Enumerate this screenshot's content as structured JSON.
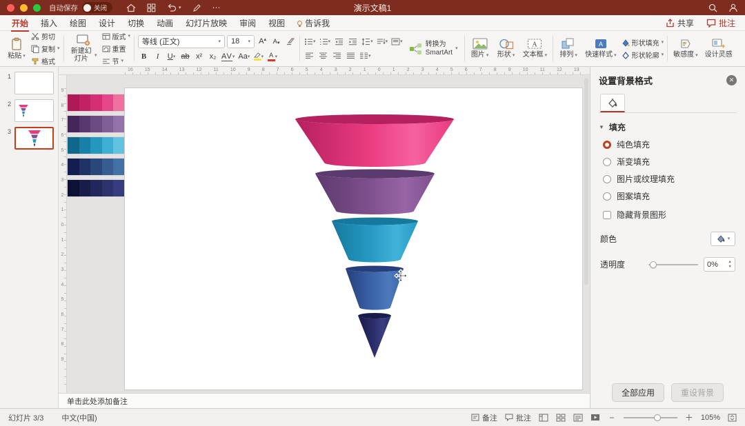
{
  "titlebar": {
    "title": "演示文稿1",
    "autosave": "自动保存",
    "autosave_state": "关闭"
  },
  "tabs": {
    "items": [
      {
        "label": "开始"
      },
      {
        "label": "插入"
      },
      {
        "label": "绘图"
      },
      {
        "label": "设计"
      },
      {
        "label": "切换"
      },
      {
        "label": "动画"
      },
      {
        "label": "幻灯片放映"
      },
      {
        "label": "审阅"
      },
      {
        "label": "视图"
      },
      {
        "label": "告诉我",
        "icon": "lightbulb-icon"
      }
    ],
    "active": "开始",
    "share": "共享",
    "comments": "批注"
  },
  "ribbon": {
    "paste": "粘贴",
    "cut": "剪切",
    "copy": "复制",
    "format_painter": "格式",
    "new_slide": "新建幻灯片",
    "layout": "版式",
    "reset": "重置",
    "section": "节",
    "font_name": "等线 (正文)",
    "font_size": "18",
    "bold": "B",
    "italic": "I",
    "underline": "U",
    "strike": "ab",
    "superscript": "x²",
    "subscript": "x₂",
    "spacing": "AV",
    "case": "Aa",
    "fontcolor": "A",
    "smartart_line1": "转换为",
    "smartart_line2": "SmartArt",
    "picture": "图片",
    "shapes": "形状",
    "textbox": "文本框",
    "arrange": "排列",
    "quick_styles": "快速样式",
    "shape_fill": "形状填充",
    "shape_outline": "形状轮廓",
    "sensitivity": "敏感度",
    "design_ideas": "设计灵感"
  },
  "slides": {
    "items": [
      {
        "num": "1"
      },
      {
        "num": "2"
      },
      {
        "num": "3"
      }
    ],
    "active": "3"
  },
  "rulers": {
    "horizontal": [
      "16",
      "15",
      "14",
      "13",
      "12",
      "11",
      "10",
      "9",
      "8",
      "7",
      "6",
      "5",
      "4",
      "3",
      "2",
      "1",
      "0",
      "1",
      "2",
      "3",
      "4",
      "5",
      "6",
      "7",
      "8",
      "9",
      "10",
      "11",
      "12",
      "13"
    ],
    "vertical": [
      "9",
      "8",
      "7",
      "6",
      "5",
      "4",
      "3",
      "2",
      "1",
      "0",
      "1",
      "2",
      "3",
      "4",
      "5",
      "6",
      "7",
      "8",
      "9"
    ]
  },
  "swatches": [
    [
      "#ad1a55",
      "#c22263",
      "#d62e72",
      "#e64687",
      "#f0709e"
    ],
    [
      "#44265a",
      "#58386e",
      "#6c4b82",
      "#805e96",
      "#9472aa"
    ],
    [
      "#0f678c",
      "#1880a6",
      "#2397be",
      "#3dafd2",
      "#61c3e0"
    ],
    [
      "#121d50",
      "#1e3266",
      "#2a477c",
      "#365c92",
      "#4271a8"
    ],
    [
      "#0d1136",
      "#171c48",
      "#21275a",
      "#2b326c",
      "#353d7e"
    ]
  ],
  "funnel": {
    "segments": [
      {
        "name": "segment-1",
        "dark": "#b5205f",
        "main": "#e93a7e",
        "light": "#f7619e"
      },
      {
        "name": "segment-2",
        "dark": "#5d3a6d",
        "main": "#7e4f8d",
        "light": "#9865a7"
      },
      {
        "name": "segment-3",
        "dark": "#15789d",
        "main": "#269ac4",
        "light": "#41b3d8"
      },
      {
        "name": "segment-4",
        "dark": "#263f7c",
        "main": "#3a63a8",
        "light": "#4d79bd"
      },
      {
        "name": "segment-5",
        "dark": "#191b49",
        "main": "#2b2d69",
        "light": "#3a3e82"
      }
    ]
  },
  "canvas": {
    "notes_placeholder": "单击此处添加备注"
  },
  "format_panel": {
    "title": "设置背景格式",
    "section_fill": "填充",
    "options": [
      {
        "label": "纯色填充",
        "selected": true
      },
      {
        "label": "渐变填充",
        "selected": false
      },
      {
        "label": "图片或纹理填充",
        "selected": false
      },
      {
        "label": "图案填充",
        "selected": false
      }
    ],
    "hide_background": "隐藏背景图形",
    "color_label": "颜色",
    "transparency_label": "透明度",
    "transparency_value": "0%",
    "apply_all": "全部应用",
    "reset_background": "重设背景"
  },
  "statusbar": {
    "slide_info": "幻灯片 3/3",
    "language": "中文(中国)",
    "notes_label": "备注",
    "comments_label": "批注",
    "zoom": "105%"
  }
}
